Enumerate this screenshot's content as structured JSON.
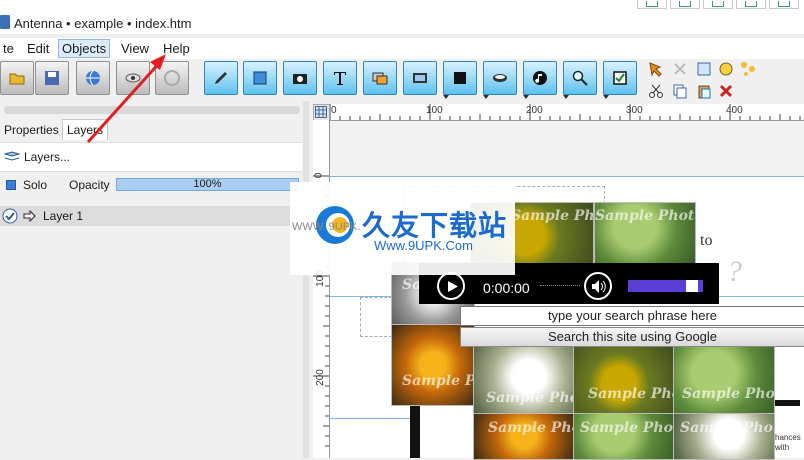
{
  "window": {
    "title": "Antenna • example • index.htm"
  },
  "menu": {
    "items": [
      "te",
      "Edit",
      "Objects",
      "View",
      "Help"
    ]
  },
  "panel": {
    "tabs": [
      "Properties",
      "Layers"
    ],
    "active_tab": "Layers",
    "layers_button": "Layers...",
    "solo_label": "Solo",
    "opacity_label": "Opacity",
    "opacity_value": "100%",
    "layer_name": "Layer 1"
  },
  "ruler": {
    "top_labels": [
      "0",
      "100",
      "200",
      "300",
      "400"
    ],
    "left_labels": [
      "0",
      "100",
      "200"
    ]
  },
  "watermark": {
    "brand": "久友下载站",
    "url_left": "WWW. 9UPK.",
    "url": "Www.9UPK.Com"
  },
  "canvas": {
    "text_to": "to",
    "text_question": "?",
    "photo_watermark": "Sample Photo",
    "corner_text_1": "hances",
    "corner_text_2": "with"
  },
  "player": {
    "time": "0:00:00",
    "volume_level": 0.85
  },
  "search": {
    "placeholder": "type your search phrase here",
    "button_label": "Search this site using Google"
  },
  "colors": {
    "accent_blue": "#5fc2ef",
    "player_volume": "#5b3ed6",
    "arrow_red": "#e02020"
  }
}
